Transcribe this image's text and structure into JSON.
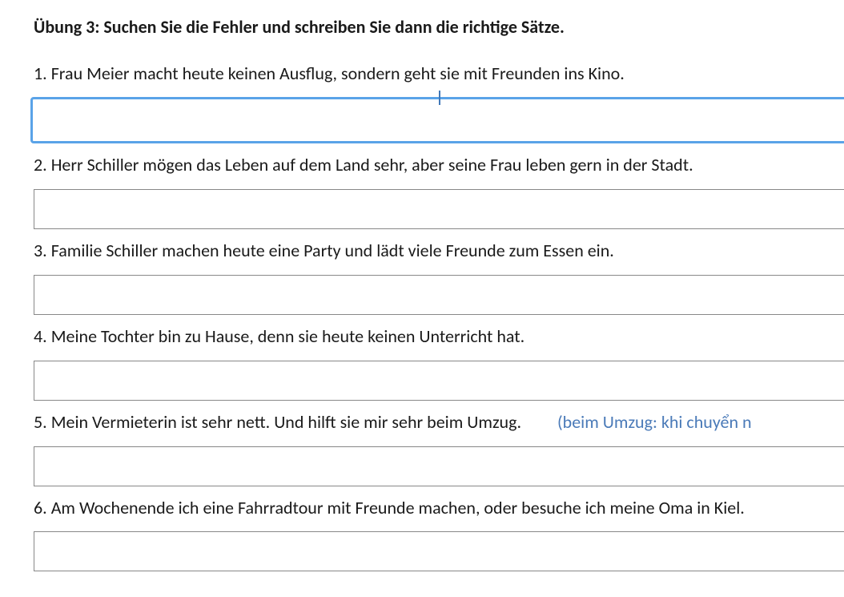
{
  "exercise": {
    "title": "Übung 3: Suchen Sie die Fehler und schreiben Sie dann die richtige Sätze.",
    "questions": [
      {
        "number": "1.",
        "text": "Frau Meier macht heute keinen Ausflug, sondern geht sie mit Freunden ins Kino.",
        "answer": "",
        "focused": true
      },
      {
        "number": "2.",
        "text": "Herr Schiller mögen das Leben auf dem Land sehr, aber seine Frau leben gern in der Stadt.",
        "answer": "",
        "focused": false
      },
      {
        "number": "3.",
        "text": "Familie Schiller machen heute eine Party und lädt viele Freunde zum Essen ein.",
        "answer": "",
        "focused": false
      },
      {
        "number": "4.",
        "text": "Meine Tochter bin zu Hause, denn sie heute keinen Unterricht hat.",
        "answer": "",
        "focused": false
      },
      {
        "number": "5.",
        "text": "Mein Vermieterin ist sehr nett. Und hilft sie mir sehr beim Umzug.",
        "hint": "(beim Umzug: khi chuyển n",
        "answer": "",
        "focused": false
      },
      {
        "number": "6.",
        "text": "Am Wochenende ich eine Fahrradtour mit Freunde machen, oder besuche ich meine Oma in Kiel.",
        "answer": "",
        "focused": false
      }
    ]
  }
}
